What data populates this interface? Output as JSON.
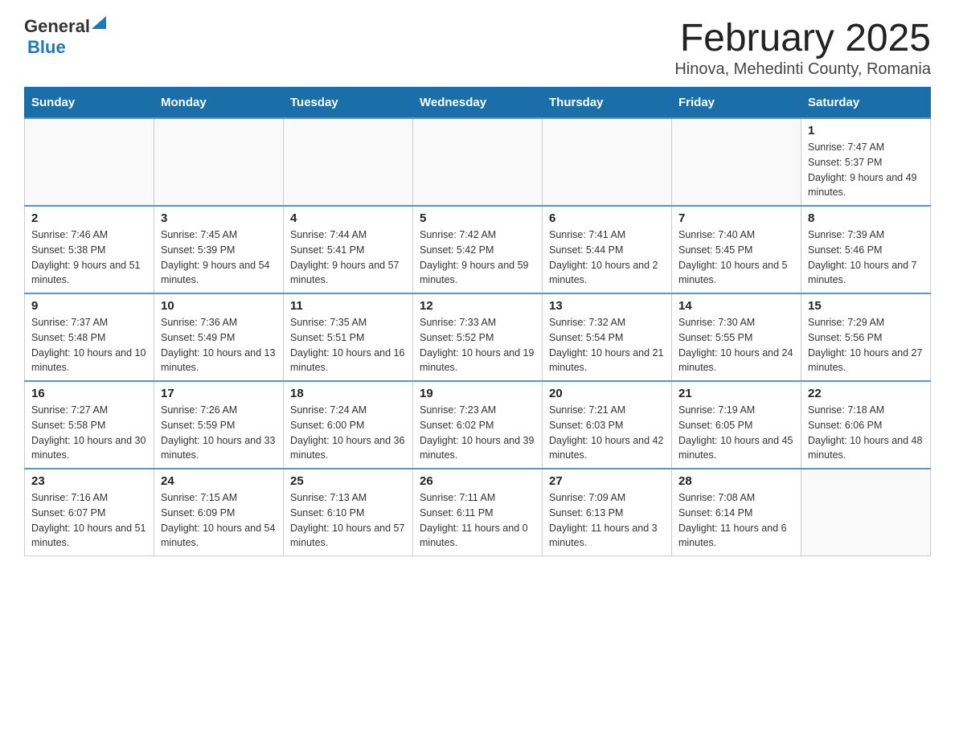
{
  "header": {
    "logo_general": "General",
    "logo_blue": "Blue",
    "title": "February 2025",
    "subtitle": "Hinova, Mehedinti County, Romania"
  },
  "days_of_week": [
    "Sunday",
    "Monday",
    "Tuesday",
    "Wednesday",
    "Thursday",
    "Friday",
    "Saturday"
  ],
  "weeks": [
    [
      {
        "day": "",
        "info": ""
      },
      {
        "day": "",
        "info": ""
      },
      {
        "day": "",
        "info": ""
      },
      {
        "day": "",
        "info": ""
      },
      {
        "day": "",
        "info": ""
      },
      {
        "day": "",
        "info": ""
      },
      {
        "day": "1",
        "info": "Sunrise: 7:47 AM\nSunset: 5:37 PM\nDaylight: 9 hours and 49 minutes."
      }
    ],
    [
      {
        "day": "2",
        "info": "Sunrise: 7:46 AM\nSunset: 5:38 PM\nDaylight: 9 hours and 51 minutes."
      },
      {
        "day": "3",
        "info": "Sunrise: 7:45 AM\nSunset: 5:39 PM\nDaylight: 9 hours and 54 minutes."
      },
      {
        "day": "4",
        "info": "Sunrise: 7:44 AM\nSunset: 5:41 PM\nDaylight: 9 hours and 57 minutes."
      },
      {
        "day": "5",
        "info": "Sunrise: 7:42 AM\nSunset: 5:42 PM\nDaylight: 9 hours and 59 minutes."
      },
      {
        "day": "6",
        "info": "Sunrise: 7:41 AM\nSunset: 5:44 PM\nDaylight: 10 hours and 2 minutes."
      },
      {
        "day": "7",
        "info": "Sunrise: 7:40 AM\nSunset: 5:45 PM\nDaylight: 10 hours and 5 minutes."
      },
      {
        "day": "8",
        "info": "Sunrise: 7:39 AM\nSunset: 5:46 PM\nDaylight: 10 hours and 7 minutes."
      }
    ],
    [
      {
        "day": "9",
        "info": "Sunrise: 7:37 AM\nSunset: 5:48 PM\nDaylight: 10 hours and 10 minutes."
      },
      {
        "day": "10",
        "info": "Sunrise: 7:36 AM\nSunset: 5:49 PM\nDaylight: 10 hours and 13 minutes."
      },
      {
        "day": "11",
        "info": "Sunrise: 7:35 AM\nSunset: 5:51 PM\nDaylight: 10 hours and 16 minutes."
      },
      {
        "day": "12",
        "info": "Sunrise: 7:33 AM\nSunset: 5:52 PM\nDaylight: 10 hours and 19 minutes."
      },
      {
        "day": "13",
        "info": "Sunrise: 7:32 AM\nSunset: 5:54 PM\nDaylight: 10 hours and 21 minutes."
      },
      {
        "day": "14",
        "info": "Sunrise: 7:30 AM\nSunset: 5:55 PM\nDaylight: 10 hours and 24 minutes."
      },
      {
        "day": "15",
        "info": "Sunrise: 7:29 AM\nSunset: 5:56 PM\nDaylight: 10 hours and 27 minutes."
      }
    ],
    [
      {
        "day": "16",
        "info": "Sunrise: 7:27 AM\nSunset: 5:58 PM\nDaylight: 10 hours and 30 minutes."
      },
      {
        "day": "17",
        "info": "Sunrise: 7:26 AM\nSunset: 5:59 PM\nDaylight: 10 hours and 33 minutes."
      },
      {
        "day": "18",
        "info": "Sunrise: 7:24 AM\nSunset: 6:00 PM\nDaylight: 10 hours and 36 minutes."
      },
      {
        "day": "19",
        "info": "Sunrise: 7:23 AM\nSunset: 6:02 PM\nDaylight: 10 hours and 39 minutes."
      },
      {
        "day": "20",
        "info": "Sunrise: 7:21 AM\nSunset: 6:03 PM\nDaylight: 10 hours and 42 minutes."
      },
      {
        "day": "21",
        "info": "Sunrise: 7:19 AM\nSunset: 6:05 PM\nDaylight: 10 hours and 45 minutes."
      },
      {
        "day": "22",
        "info": "Sunrise: 7:18 AM\nSunset: 6:06 PM\nDaylight: 10 hours and 48 minutes."
      }
    ],
    [
      {
        "day": "23",
        "info": "Sunrise: 7:16 AM\nSunset: 6:07 PM\nDaylight: 10 hours and 51 minutes."
      },
      {
        "day": "24",
        "info": "Sunrise: 7:15 AM\nSunset: 6:09 PM\nDaylight: 10 hours and 54 minutes."
      },
      {
        "day": "25",
        "info": "Sunrise: 7:13 AM\nSunset: 6:10 PM\nDaylight: 10 hours and 57 minutes."
      },
      {
        "day": "26",
        "info": "Sunrise: 7:11 AM\nSunset: 6:11 PM\nDaylight: 11 hours and 0 minutes."
      },
      {
        "day": "27",
        "info": "Sunrise: 7:09 AM\nSunset: 6:13 PM\nDaylight: 11 hours and 3 minutes."
      },
      {
        "day": "28",
        "info": "Sunrise: 7:08 AM\nSunset: 6:14 PM\nDaylight: 11 hours and 6 minutes."
      },
      {
        "day": "",
        "info": ""
      }
    ]
  ]
}
